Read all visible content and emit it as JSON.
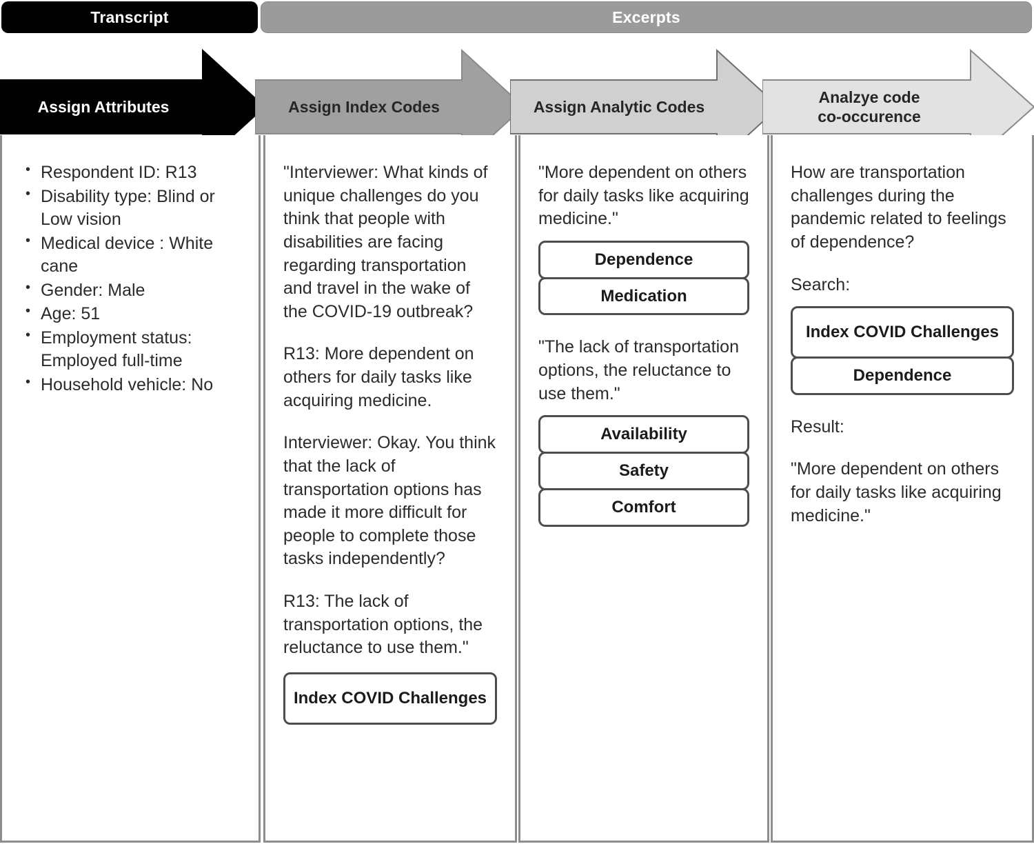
{
  "headers": [
    {
      "label": "Transcript",
      "bg": "#000000",
      "fg": "#ffffff"
    },
    {
      "label": "Excerpts",
      "bg": "#9b9b9b",
      "fg": "#ffffff"
    }
  ],
  "stages": [
    {
      "label_line1": "Assign Attributes",
      "label_line2": "",
      "fill": "#000000",
      "stroke": "#000000",
      "text_color": "#ffffff"
    },
    {
      "label_line1": "Assign Index Codes",
      "label_line2": "",
      "fill": "#a0a0a0",
      "stroke": "#8a8a8a",
      "text_color": "#262626"
    },
    {
      "label_line1": "Assign Analytic Codes",
      "label_line2": "",
      "fill": "#d0d0d0",
      "stroke": "#6e6e6e",
      "text_color": "#262626"
    },
    {
      "label_line1": "Analzye code",
      "label_line2": "co-occurence",
      "fill": "#e2e2e2",
      "stroke": "#8a8a8a",
      "text_color": "#262626"
    }
  ],
  "columns": {
    "attributes": {
      "items": [
        "Respondent ID: R13",
        "Disability type: Blind or Low vision",
        "Medical device : White cane",
        "Gender: Male",
        "Age: 51",
        "Employment status: Employed full-time",
        "Household vehicle: No"
      ]
    },
    "index_codes": {
      "paragraphs": [
        "\"Interviewer: What kinds of unique challenges do you think that people with disabilities are facing regarding transportation and travel in the wake of the COVID-19 outbreak?",
        "R13: More dependent on others for daily tasks like acquiring medicine.",
        "Interviewer: Okay. You think that the lack of transportation options has made it more difficult for people to complete those tasks independently?",
        "R13: The lack of transportation options, the reluctance to use them.\""
      ],
      "codes": [
        {
          "label": "Index COVID Challenges",
          "tall": true
        }
      ]
    },
    "analytic_codes": {
      "excerpt_1": "\"More dependent on others for daily tasks like acquiring medicine.\"",
      "codes_1": [
        {
          "label": "Dependence",
          "tall": false
        },
        {
          "label": "Medication",
          "tall": false
        }
      ],
      "excerpt_2": "\"The lack of transportation options, the reluctance to use them.\"",
      "codes_2": [
        {
          "label": "Availability",
          "tall": false
        },
        {
          "label": "Safety",
          "tall": false
        },
        {
          "label": "Comfort",
          "tall": false
        }
      ]
    },
    "co_occurrence": {
      "question": "How are transportation challenges during the pandemic related to feelings of dependence?",
      "search_label": "Search:",
      "search_codes": [
        {
          "label": "Index COVID Challenges",
          "tall": true
        },
        {
          "label": "Dependence",
          "tall": false
        }
      ],
      "result_label": "Result:",
      "result_text": "\"More dependent on others for daily tasks like acquiring medicine.\""
    }
  }
}
